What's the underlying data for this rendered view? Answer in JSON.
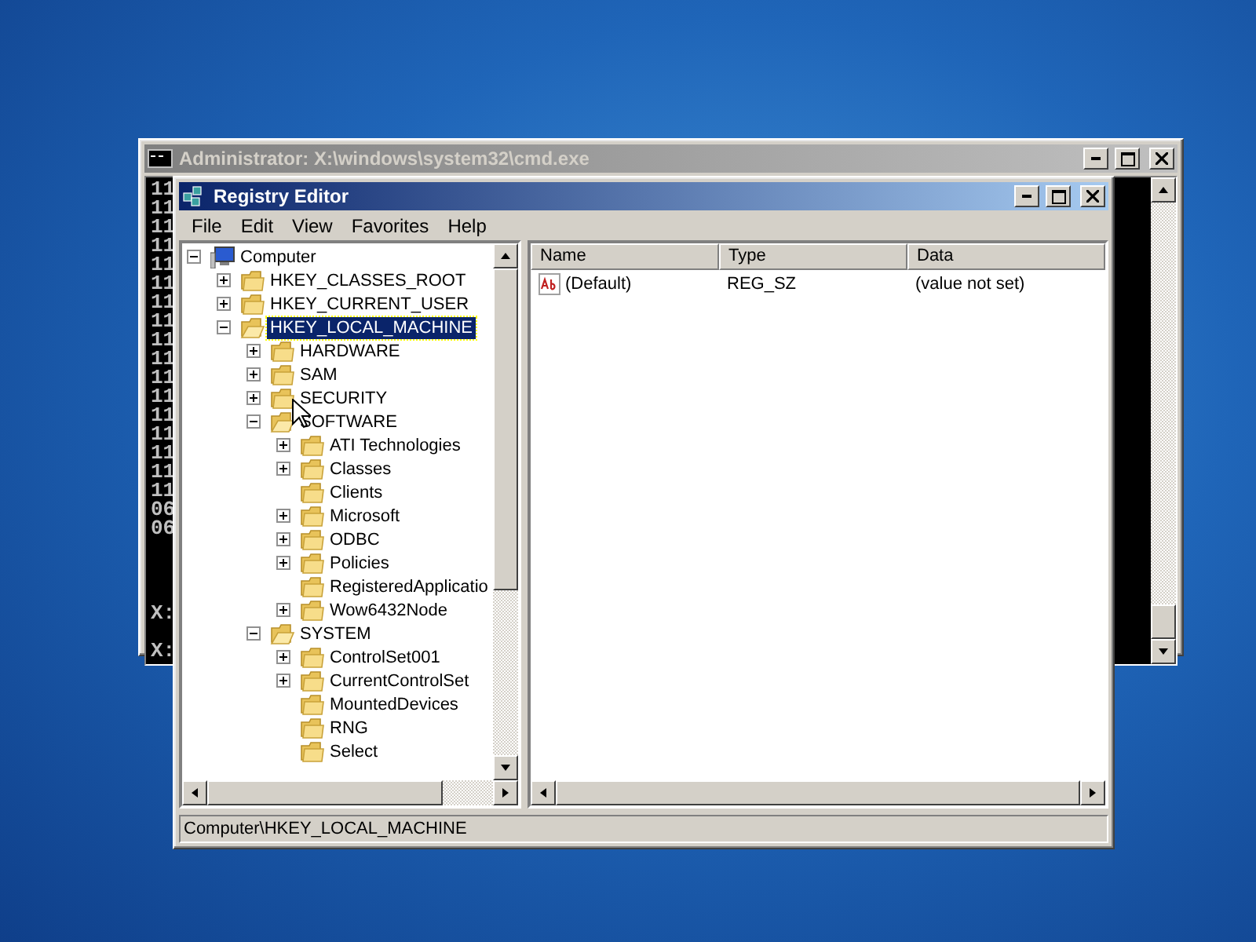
{
  "console_window": {
    "title": "Administrator: X:\\windows\\system32\\cmd.exe",
    "active": false,
    "lines": [
      "11",
      "11",
      "11",
      "11",
      "11",
      "11",
      "11",
      "11",
      "11",
      "11",
      "11",
      "11",
      "11",
      "11",
      "11",
      "11",
      "11",
      "06",
      "06"
    ],
    "prompts": [
      "X:",
      "X:"
    ]
  },
  "registry_window": {
    "title": "Registry Editor",
    "active": true,
    "menu": [
      "File",
      "Edit",
      "View",
      "Favorites",
      "Help"
    ],
    "tree": [
      {
        "label": "Computer",
        "kind": "branch",
        "expanded": true,
        "selected": false,
        "children": [
          {
            "label": "HKEY_CLASSES_ROOT",
            "kind": "branch",
            "expanded": false,
            "selected": false
          },
          {
            "label": "HKEY_CURRENT_USER",
            "kind": "branch",
            "expanded": false,
            "selected": false
          },
          {
            "label": "HKEY_LOCAL_MACHINE",
            "kind": "branch",
            "expanded": true,
            "selected": true,
            "children": [
              {
                "label": "HARDWARE",
                "kind": "branch",
                "expanded": false,
                "selected": false
              },
              {
                "label": "SAM",
                "kind": "branch",
                "expanded": false,
                "selected": false
              },
              {
                "label": "SECURITY",
                "kind": "branch",
                "expanded": false,
                "selected": false
              },
              {
                "label": "SOFTWARE",
                "kind": "branch",
                "expanded": true,
                "selected": false,
                "children": [
                  {
                    "label": "ATI Technologies",
                    "kind": "branch",
                    "expanded": false,
                    "selected": false
                  },
                  {
                    "label": "Classes",
                    "kind": "branch",
                    "expanded": false,
                    "selected": false
                  },
                  {
                    "label": "Clients",
                    "kind": "leaf",
                    "expanded": false,
                    "selected": false
                  },
                  {
                    "label": "Microsoft",
                    "kind": "branch",
                    "expanded": false,
                    "selected": false
                  },
                  {
                    "label": "ODBC",
                    "kind": "branch",
                    "expanded": false,
                    "selected": false
                  },
                  {
                    "label": "Policies",
                    "kind": "branch",
                    "expanded": false,
                    "selected": false
                  },
                  {
                    "label": "RegisteredApplicatio",
                    "kind": "leaf",
                    "expanded": false,
                    "selected": false
                  },
                  {
                    "label": "Wow6432Node",
                    "kind": "branch",
                    "expanded": false,
                    "selected": false
                  }
                ]
              },
              {
                "label": "SYSTEM",
                "kind": "branch",
                "expanded": true,
                "selected": false,
                "children": [
                  {
                    "label": "ControlSet001",
                    "kind": "branch",
                    "expanded": false,
                    "selected": false
                  },
                  {
                    "label": "CurrentControlSet",
                    "kind": "branch",
                    "expanded": false,
                    "selected": false
                  },
                  {
                    "label": "MountedDevices",
                    "kind": "leaf",
                    "expanded": false,
                    "selected": false
                  },
                  {
                    "label": "RNG",
                    "kind": "leaf",
                    "expanded": false,
                    "selected": false
                  },
                  {
                    "label": "Select",
                    "kind": "leaf",
                    "expanded": false,
                    "selected": false
                  }
                ]
              }
            ]
          }
        ]
      }
    ],
    "columns": [
      "Name",
      "Type",
      "Data"
    ],
    "values": [
      {
        "name": "(Default)",
        "type": "REG_SZ",
        "data": "(value not set)"
      }
    ],
    "status": "Computer\\HKEY_LOCAL_MACHINE"
  }
}
